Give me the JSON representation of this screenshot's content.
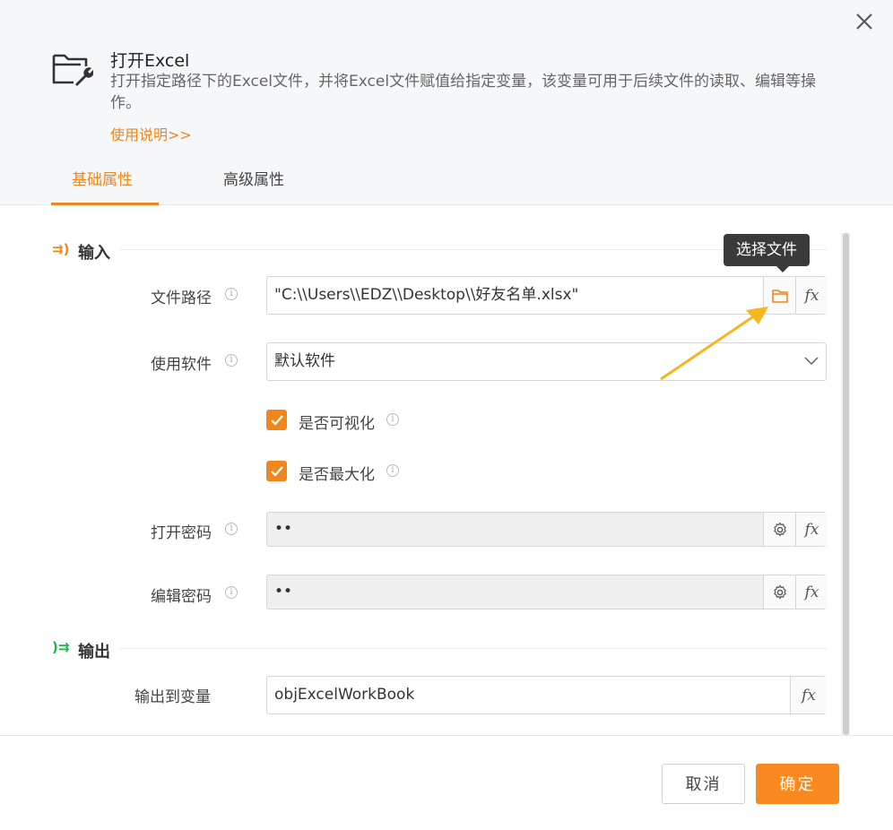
{
  "header": {
    "title": "打开Excel",
    "description": "打开指定路径下的Excel文件，并将Excel文件赋值给指定变量，该变量可用于后续文件的读取、编辑等操作。",
    "usage_link": "使用说明>>",
    "tabs": [
      {
        "label": "基础属性",
        "active": true
      },
      {
        "label": "高级属性",
        "active": false
      }
    ]
  },
  "input_section": {
    "title": "输入",
    "fields": {
      "file_path": {
        "label": "文件路径",
        "value": "\"C:\\\\Users\\\\EDZ\\\\Desktop\\\\好友名单.xlsx\""
      },
      "software": {
        "label": "使用软件",
        "value": "默认软件"
      },
      "visible": {
        "label": "是否可视化",
        "checked": true
      },
      "maximize": {
        "label": "是否最大化",
        "checked": true
      },
      "open_password": {
        "label": "打开密码",
        "value": "••"
      },
      "edit_password": {
        "label": "编辑密码",
        "value": "••"
      }
    }
  },
  "output_section": {
    "title": "输出",
    "fields": {
      "output_var": {
        "label": "输出到变量",
        "value": "objExcelWorkBook"
      }
    }
  },
  "tooltip": {
    "text": "选择文件"
  },
  "footer": {
    "cancel_label": "取消",
    "ok_label": "确定"
  },
  "icons": {
    "folder": "folder-icon",
    "fx": "fx-icon",
    "gear": "gear-icon",
    "info": "info-icon",
    "chevron": "chevron-down-icon",
    "close": "close-icon",
    "check": "check-icon"
  },
  "fx_symbol": "fx",
  "info_symbol": "i",
  "colors": {
    "accent": "#f0871e",
    "primary_button": "#f8891f",
    "annotation_arrow": "#f5b81c"
  }
}
